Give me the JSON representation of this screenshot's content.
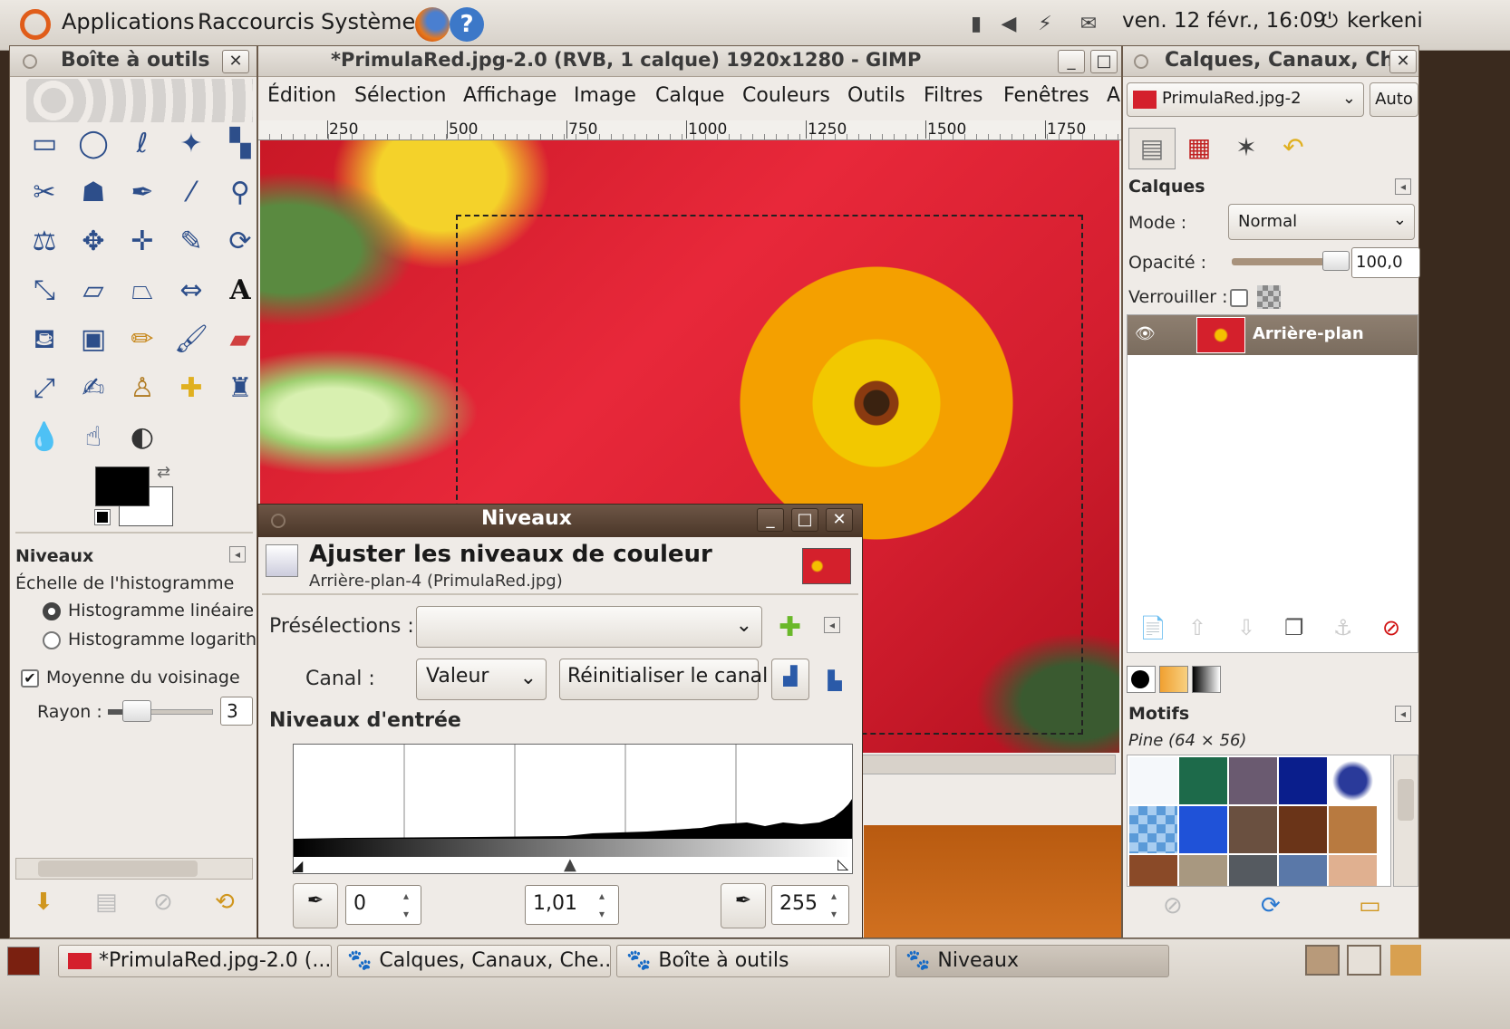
{
  "top_panel": {
    "menus": [
      "Applications",
      "Raccourcis",
      "Système"
    ],
    "datetime": "ven. 12 févr., 16:09",
    "user": "kerkeni"
  },
  "toolbox": {
    "title": "Boîte à outils",
    "options_title": "Niveaux",
    "histogram_scale": "Échelle de l'histogramme",
    "linear": "Histogramme linéaire",
    "log": "Histogramme logarithn",
    "average": "Moyenne du voisinage",
    "radius_label": "Rayon :",
    "radius_value": "3"
  },
  "image_window": {
    "title": "*PrimulaRed.jpg-2.0 (RVB, 1 calque) 1920x1280 - GIMP",
    "menus": [
      "Édition",
      "Sélection",
      "Affichage",
      "Image",
      "Calque",
      "Couleurs",
      "Outils",
      "Filtres",
      "Fenêtres",
      "A"
    ],
    "ruler_ticks": [
      "250",
      "500",
      "750",
      "1000",
      "1250",
      "1500",
      "1750"
    ]
  },
  "layers_dock": {
    "title": "Calques, Canaux, Ch",
    "image_select": "PrimulaRed.jpg-2",
    "auto_label": "Auto",
    "section": "Calques",
    "mode_label": "Mode :",
    "mode_value": "Normal",
    "opacity_label": "Opacité :",
    "opacity_value": "100,0",
    "opacity_fraction": 1.0,
    "lock_label": "Verrouiller :",
    "layer_name": "Arrière-plan",
    "patterns_title": "Motifs",
    "pattern_name": "Pine (64 × 56)"
  },
  "levels_dialog": {
    "title": "Niveaux",
    "heading": "Ajuster les niveaux de couleur",
    "subheading": "Arrière-plan-4 (PrimulaRed.jpg)",
    "presets_label": "Présélections :",
    "channel_label": "Canal :",
    "channel_value": "Valeur",
    "reset_channel": "Réinitialiser le canal",
    "input_levels": "Niveaux d'entrée",
    "low_value": "0",
    "gamma_value": "1,01",
    "high_value": "255"
  },
  "taskbar": {
    "tasks": [
      "*PrimulaRed.jpg-2.0 (...",
      "Calques, Canaux, Che...",
      "Boîte à outils",
      "Niveaux"
    ]
  },
  "colors": {
    "panel": "#efebe7",
    "accent_title": "#5a4333",
    "flower_red": "#d9232f",
    "flower_yellow": "#f4b800"
  }
}
